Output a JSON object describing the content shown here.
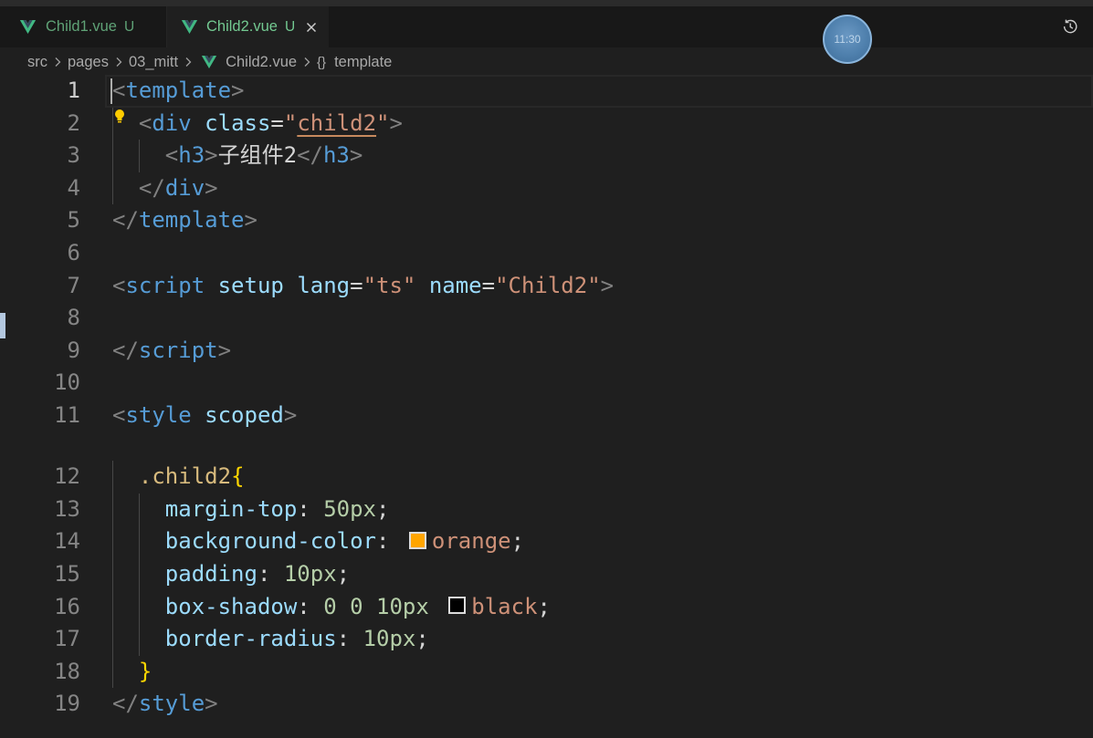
{
  "theme": {
    "editor_background": "#1f1f1f",
    "git_untracked": "#73c991",
    "warning_underline": "#c78a5e",
    "syntax": {
      "punct": "#808080",
      "tag": "#569cd6",
      "attr": "#9cdcfe",
      "op": "#d4d4d4",
      "str": "#ce9178",
      "text": "#d4d4d4",
      "sel": "#d7ba7d",
      "brace": "#ffd700",
      "prop": "#9cdcfe",
      "num": "#b5cea8",
      "ws": "#d4d4d4"
    }
  },
  "tabs": [
    {
      "label": "Child1.vue",
      "status": "U",
      "icon": "vue-icon",
      "active": false
    },
    {
      "label": "Child2.vue",
      "status": "U",
      "icon": "vue-icon",
      "active": true,
      "close_icon": "close-icon"
    }
  ],
  "toolbar": {
    "history_icon": "history-icon"
  },
  "clock": {
    "time": "11:30"
  },
  "breadcrumb": {
    "separator_icon": "chevron-right-icon",
    "items": [
      {
        "label": "src"
      },
      {
        "label": "pages"
      },
      {
        "label": "03_mitt"
      },
      {
        "label": "Child2.vue",
        "icon": "vue-icon"
      },
      {
        "label": "template",
        "icon": "braces-icon",
        "glyph": "{}"
      }
    ]
  },
  "editor": {
    "active_line": 1,
    "lightbulb_icon": "lightbulb-icon",
    "lines": [
      {
        "n": "1",
        "tokens": [
          {
            "k": "punct",
            "t": "<"
          },
          {
            "k": "tag",
            "t": "template"
          },
          {
            "k": "punct",
            "t": ">"
          }
        ]
      },
      {
        "n": "2",
        "tokens": [
          {
            "k": "ws",
            "t": "  "
          },
          {
            "k": "punct",
            "t": "<"
          },
          {
            "k": "tag",
            "t": "div"
          },
          {
            "k": "ws",
            "t": " "
          },
          {
            "k": "attr",
            "t": "class"
          },
          {
            "k": "op",
            "t": "="
          },
          {
            "k": "str",
            "t": "\""
          },
          {
            "k": "str",
            "t": "child2",
            "warn": true
          },
          {
            "k": "str",
            "t": "\""
          },
          {
            "k": "punct",
            "t": ">"
          }
        ]
      },
      {
        "n": "3",
        "tokens": [
          {
            "k": "ws",
            "t": "    "
          },
          {
            "k": "punct",
            "t": "<"
          },
          {
            "k": "tag",
            "t": "h3"
          },
          {
            "k": "punct",
            "t": ">"
          },
          {
            "k": "text",
            "t": "子组件2"
          },
          {
            "k": "punct",
            "t": "</"
          },
          {
            "k": "tag",
            "t": "h3"
          },
          {
            "k": "punct",
            "t": ">"
          }
        ]
      },
      {
        "n": "4",
        "tokens": [
          {
            "k": "ws",
            "t": "  "
          },
          {
            "k": "punct",
            "t": "</"
          },
          {
            "k": "tag",
            "t": "div"
          },
          {
            "k": "punct",
            "t": ">"
          }
        ]
      },
      {
        "n": "5",
        "tokens": [
          {
            "k": "punct",
            "t": "</"
          },
          {
            "k": "tag",
            "t": "template"
          },
          {
            "k": "punct",
            "t": ">"
          }
        ]
      },
      {
        "n": "6",
        "tokens": []
      },
      {
        "n": "7",
        "tokens": [
          {
            "k": "punct",
            "t": "<"
          },
          {
            "k": "tag",
            "t": "script"
          },
          {
            "k": "ws",
            "t": " "
          },
          {
            "k": "attr",
            "t": "setup"
          },
          {
            "k": "ws",
            "t": " "
          },
          {
            "k": "attr",
            "t": "lang"
          },
          {
            "k": "op",
            "t": "="
          },
          {
            "k": "str",
            "t": "\"ts\""
          },
          {
            "k": "ws",
            "t": " "
          },
          {
            "k": "attr",
            "t": "name"
          },
          {
            "k": "op",
            "t": "="
          },
          {
            "k": "str",
            "t": "\"Child2\""
          },
          {
            "k": "punct",
            "t": ">"
          }
        ]
      },
      {
        "n": "8",
        "tokens": []
      },
      {
        "n": "9",
        "tokens": [
          {
            "k": "punct",
            "t": "</"
          },
          {
            "k": "tag",
            "t": "script"
          },
          {
            "k": "punct",
            "t": ">"
          }
        ]
      },
      {
        "n": "10",
        "tokens": []
      },
      {
        "n": "11",
        "tokens": [
          {
            "k": "punct",
            "t": "<"
          },
          {
            "k": "tag",
            "t": "style"
          },
          {
            "k": "ws",
            "t": " "
          },
          {
            "k": "attr",
            "t": "scoped"
          },
          {
            "k": "punct",
            "t": ">"
          }
        ]
      },
      {
        "n": "12",
        "tokens": [
          {
            "k": "ws",
            "t": "  "
          },
          {
            "k": "sel",
            "t": ".child2"
          },
          {
            "k": "brace",
            "t": "{"
          }
        ]
      },
      {
        "n": "13",
        "tokens": [
          {
            "k": "ws",
            "t": "    "
          },
          {
            "k": "prop",
            "t": "margin-top"
          },
          {
            "k": "op",
            "t": ":"
          },
          {
            "k": "ws",
            "t": " "
          },
          {
            "k": "num",
            "t": "50px"
          },
          {
            "k": "op",
            "t": ";"
          }
        ]
      },
      {
        "n": "14",
        "tokens": [
          {
            "k": "ws",
            "t": "    "
          },
          {
            "k": "prop",
            "t": "background-color"
          },
          {
            "k": "op",
            "t": ":"
          },
          {
            "k": "ws",
            "t": " "
          },
          {
            "k": "swatch",
            "color": "#ffa500"
          },
          {
            "k": "str",
            "t": "orange"
          },
          {
            "k": "op",
            "t": ";"
          }
        ]
      },
      {
        "n": "15",
        "tokens": [
          {
            "k": "ws",
            "t": "    "
          },
          {
            "k": "prop",
            "t": "padding"
          },
          {
            "k": "op",
            "t": ":"
          },
          {
            "k": "ws",
            "t": " "
          },
          {
            "k": "num",
            "t": "10px"
          },
          {
            "k": "op",
            "t": ";"
          }
        ]
      },
      {
        "n": "16",
        "tokens": [
          {
            "k": "ws",
            "t": "    "
          },
          {
            "k": "prop",
            "t": "box-shadow"
          },
          {
            "k": "op",
            "t": ":"
          },
          {
            "k": "ws",
            "t": " "
          },
          {
            "k": "num",
            "t": "0"
          },
          {
            "k": "ws",
            "t": " "
          },
          {
            "k": "num",
            "t": "0"
          },
          {
            "k": "ws",
            "t": " "
          },
          {
            "k": "num",
            "t": "10px"
          },
          {
            "k": "ws",
            "t": " "
          },
          {
            "k": "swatch",
            "color": "#000000"
          },
          {
            "k": "str",
            "t": "black"
          },
          {
            "k": "op",
            "t": ";"
          }
        ]
      },
      {
        "n": "17",
        "tokens": [
          {
            "k": "ws",
            "t": "    "
          },
          {
            "k": "prop",
            "t": "border-radius"
          },
          {
            "k": "op",
            "t": ":"
          },
          {
            "k": "ws",
            "t": " "
          },
          {
            "k": "num",
            "t": "10px"
          },
          {
            "k": "op",
            "t": ";"
          }
        ]
      },
      {
        "n": "18",
        "tokens": [
          {
            "k": "ws",
            "t": "  "
          },
          {
            "k": "brace",
            "t": "}"
          }
        ]
      },
      {
        "n": "19",
        "tokens": [
          {
            "k": "punct",
            "t": "</"
          },
          {
            "k": "tag",
            "t": "style"
          },
          {
            "k": "punct",
            "t": ">"
          }
        ]
      }
    ]
  }
}
